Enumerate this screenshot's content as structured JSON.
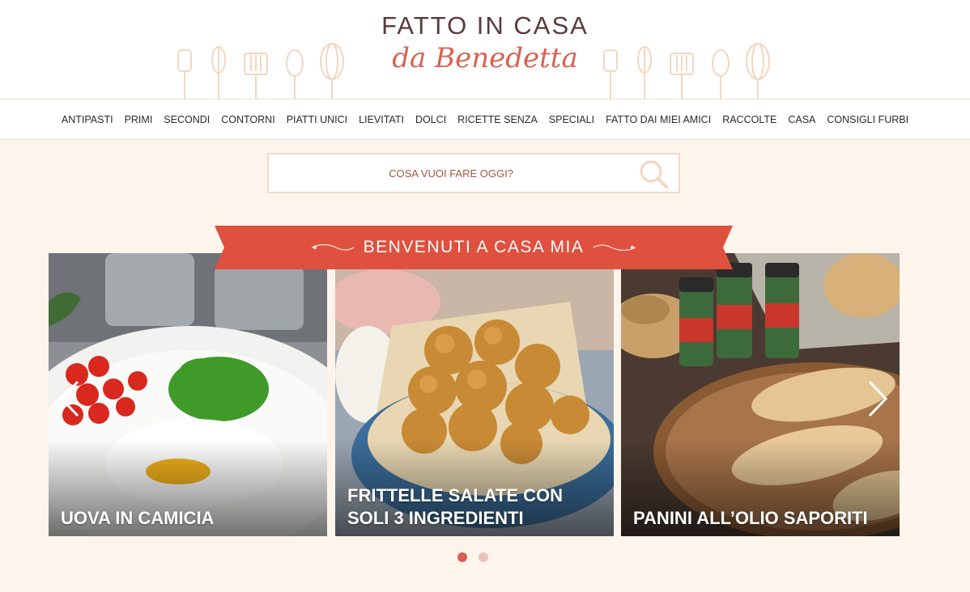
{
  "brand": {
    "title": "FATTO IN CASA",
    "subtitle": "da Benedetta"
  },
  "nav": {
    "items": [
      "ANTIPASTI",
      "PRIMI",
      "SECONDI",
      "CONTORNI",
      "PIATTI UNICI",
      "LIEVITATI",
      "DOLCI",
      "RICETTE SENZA",
      "SPECIALI",
      "FATTO DAI MIEI AMICI",
      "RACCOLTE",
      "CASA",
      "CONSIGLI FURBI"
    ]
  },
  "search": {
    "placeholder": "COSA VUOI FARE OGGI?",
    "icon": "search-icon"
  },
  "banner": {
    "text": "BENVENUTI A CASA MIA"
  },
  "slides": [
    {
      "title": "UOVA IN CAMICIA"
    },
    {
      "title": "FRITTELLE SALATE CON SOLI 3 INGREDIENTI"
    },
    {
      "title": "PANINI ALL’OLIO SAPORITI"
    }
  ],
  "slider": {
    "prev_icon": "chevron-left-icon",
    "next_icon": "chevron-right-icon",
    "active_dot": 1,
    "dot_count": 2
  },
  "colors": {
    "accent": "#d9614f",
    "background": "#fdf4ec",
    "nav_text": "#2a2a2a",
    "search_text": "#a0583e",
    "dot_active": "#d9614f",
    "dot_inactive": "#e8c5b4"
  }
}
